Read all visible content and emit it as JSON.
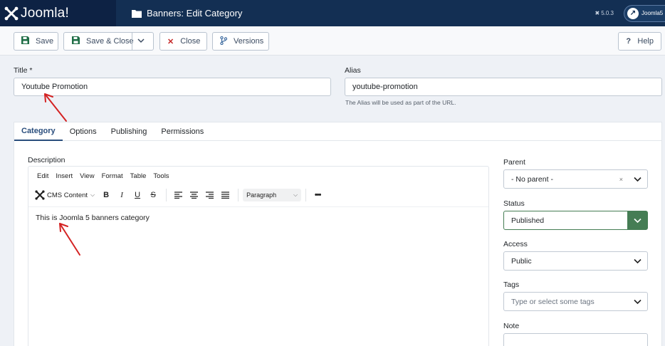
{
  "header": {
    "logo_text": "Joomla!",
    "title": "Banners: Edit Category",
    "version": "5.0.3",
    "site_link": "Joomla5"
  },
  "toolbar": {
    "save": "Save",
    "save_close": "Save & Close",
    "close": "Close",
    "versions": "Versions",
    "help": "Help"
  },
  "form": {
    "title_label": "Title *",
    "title_value": "Youtube Promotion",
    "alias_label": "Alias",
    "alias_value": "youtube-promotion",
    "alias_hint": "The Alias will be used as part of the URL."
  },
  "tabs": [
    "Category",
    "Options",
    "Publishing",
    "Permissions"
  ],
  "editor": {
    "label": "Description",
    "menu": [
      "Edit",
      "Insert",
      "View",
      "Format",
      "Table",
      "Tools"
    ],
    "cms_content": "CMS Content",
    "paragraph": "Paragraph",
    "content": "This is Joomla 5 banners category"
  },
  "sidebar": {
    "parent_label": "Parent",
    "parent_value": "- No parent -",
    "status_label": "Status",
    "status_value": "Published",
    "access_label": "Access",
    "access_value": "Public",
    "tags_label": "Tags",
    "tags_placeholder": "Type or select some tags",
    "note_label": "Note"
  },
  "colors": {
    "header_bg": "#132f53",
    "status_accent": "#457d54",
    "annotation_arrow": "#d42323"
  }
}
